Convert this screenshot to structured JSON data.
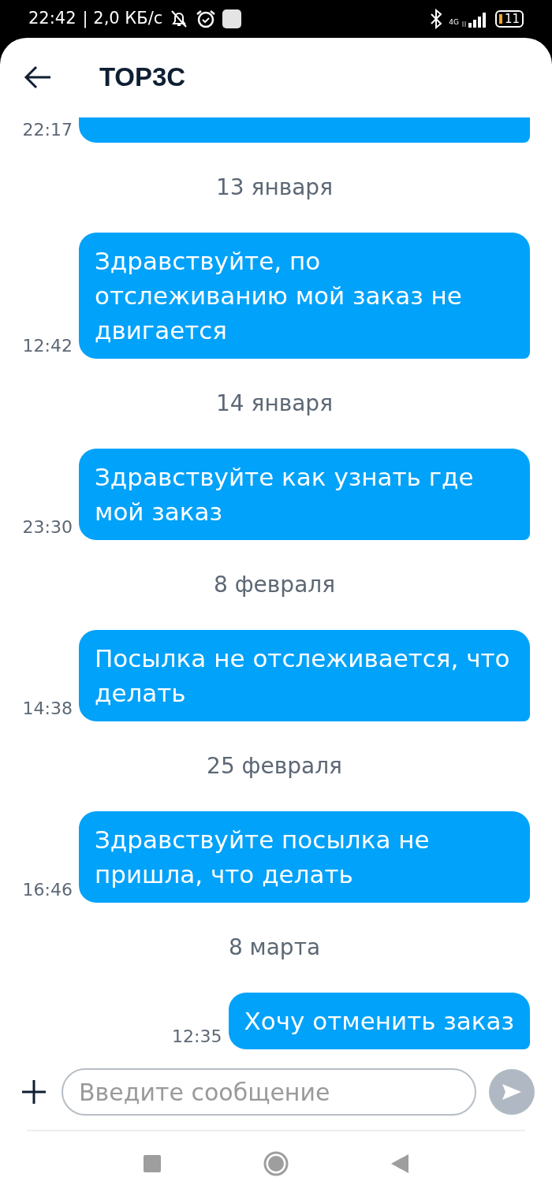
{
  "status_bar": {
    "time": "22:42",
    "speed": "| 2,0 КБ/с",
    "network": "4G",
    "battery": "11"
  },
  "header": {
    "title": "ТОР3С"
  },
  "items": [
    {
      "kind": "message",
      "time": "22:17"
    },
    {
      "kind": "date",
      "text": "13 января"
    },
    {
      "kind": "message",
      "text": "Здравствуйте, по отслеживанию мой заказ не двигается",
      "time": "12:42"
    },
    {
      "kind": "date",
      "text": "14 января"
    },
    {
      "kind": "message",
      "text": "Здравствуйте как узнать где мой заказ",
      "time": "23:30"
    },
    {
      "kind": "date",
      "text": "8 февраля"
    },
    {
      "kind": "message",
      "text": "Посылка не отслеживается, что делать",
      "time": "14:38"
    },
    {
      "kind": "date",
      "text": "25 февраля"
    },
    {
      "kind": "message",
      "text": "Здравствуйте посылка не пришла, что делать",
      "time": "16:46"
    },
    {
      "kind": "date",
      "text": "8 марта"
    },
    {
      "kind": "message",
      "text": "Хочу отменить заказ",
      "time": "12:35"
    }
  ],
  "composer": {
    "placeholder": "Введите сообщение"
  }
}
